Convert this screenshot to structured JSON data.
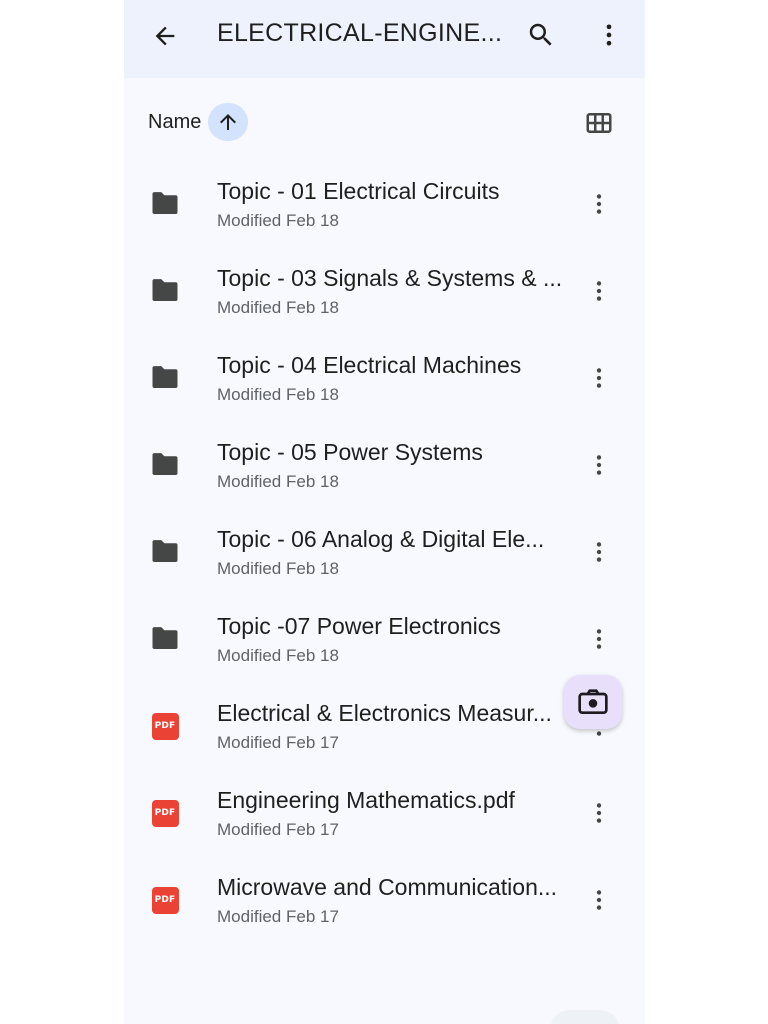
{
  "appbar": {
    "title": "ELECTRICAL-ENGINE...",
    "back_icon": "arrow-back-icon",
    "search_icon": "search-icon",
    "more_icon": "more-vert-icon"
  },
  "sort": {
    "label": "Name",
    "direction": "ascending",
    "direction_icon": "arrow-upward-icon",
    "view_icon": "grid-view-icon"
  },
  "files": [
    {
      "type": "folder",
      "icon": "folder-icon",
      "name": "Topic - 01 Electrical Circuits",
      "modified": "Modified Feb 18"
    },
    {
      "type": "folder",
      "icon": "folder-icon",
      "name": "Topic - 03 Signals & Systems & ...",
      "modified": "Modified Feb 18"
    },
    {
      "type": "folder",
      "icon": "folder-icon",
      "name": "Topic - 04 Electrical Machines",
      "modified": "Modified Feb 18"
    },
    {
      "type": "folder",
      "icon": "folder-icon",
      "name": "Topic - 05 Power Systems",
      "modified": "Modified Feb 18"
    },
    {
      "type": "folder",
      "icon": "folder-icon",
      "name": "Topic - 06 Analog & Digital Ele...",
      "modified": "Modified Feb 18"
    },
    {
      "type": "folder",
      "icon": "folder-icon",
      "name": "Topic -07 Power Electronics",
      "modified": "Modified Feb 18"
    },
    {
      "type": "pdf",
      "icon": "pdf-icon",
      "badge": "PDF",
      "name": "Electrical & Electronics Measur...",
      "modified": "Modified Feb 17"
    },
    {
      "type": "pdf",
      "icon": "pdf-icon",
      "badge": "PDF",
      "name": "Engineering Mathematics.pdf",
      "modified": "Modified Feb 17"
    },
    {
      "type": "pdf",
      "icon": "pdf-icon",
      "badge": "PDF",
      "name": "Microwave and Communication...",
      "modified": "Modified Feb 17"
    }
  ],
  "fab": {
    "icon": "camera-scan-icon"
  },
  "colors": {
    "appbar_bg": "#edf2fc",
    "page_bg": "#f7f9fe",
    "sort_chip": "#d3e3fd",
    "pdf_red": "#ea4335",
    "fab_bg": "#e8e0fb"
  }
}
